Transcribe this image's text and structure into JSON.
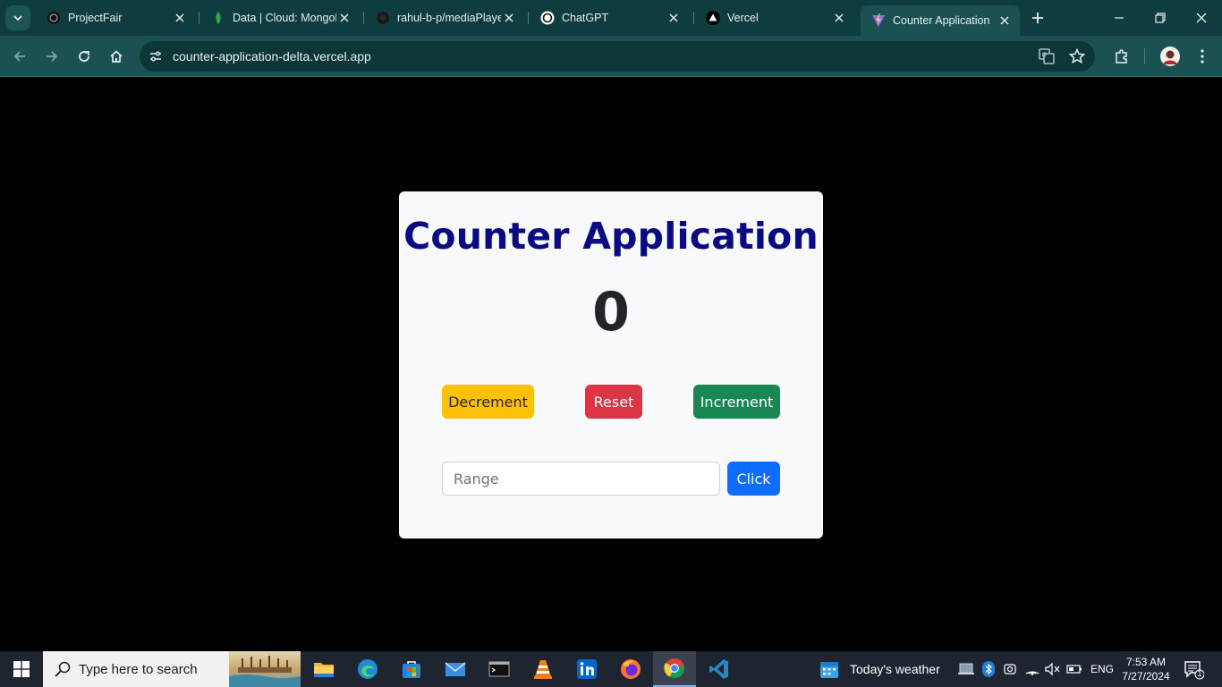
{
  "browser": {
    "tabs": [
      {
        "title": "ProjectFair",
        "icon": "projectfair-favicon"
      },
      {
        "title": "Data | Cloud: MongoD",
        "icon": "mongodb-leaf-icon"
      },
      {
        "title": "rahul-b-p/mediaPlaye",
        "icon": "github-icon"
      },
      {
        "title": "ChatGPT",
        "icon": "chatgpt-icon"
      },
      {
        "title": "Vercel",
        "icon": "vercel-triangle-icon"
      },
      {
        "title": "Counter Application",
        "icon": "vite-icon",
        "active": true
      }
    ],
    "url": "counter-application-delta.vercel.app"
  },
  "app": {
    "title": "Counter Application",
    "count": "0",
    "decrement_label": "Decrement",
    "reset_label": "Reset",
    "increment_label": "Increment",
    "range_placeholder": "Range",
    "range_value": "",
    "click_label": "Click",
    "colors": {
      "title": "#0a0a82",
      "decrement": "#ffc107",
      "reset": "#dc3545",
      "increment": "#198754",
      "click": "#0d6efd"
    }
  },
  "taskbar": {
    "search_placeholder": "Type here to search",
    "weather": "Today's weather",
    "language": "ENG",
    "time": "7:53 AM",
    "date": "7/27/2024",
    "notification_count": "1",
    "apps": [
      "file-explorer",
      "edge",
      "microsoft-store",
      "mail",
      "terminal",
      "vlc",
      "linkedin",
      "firefox",
      "chrome",
      "vscode"
    ]
  }
}
